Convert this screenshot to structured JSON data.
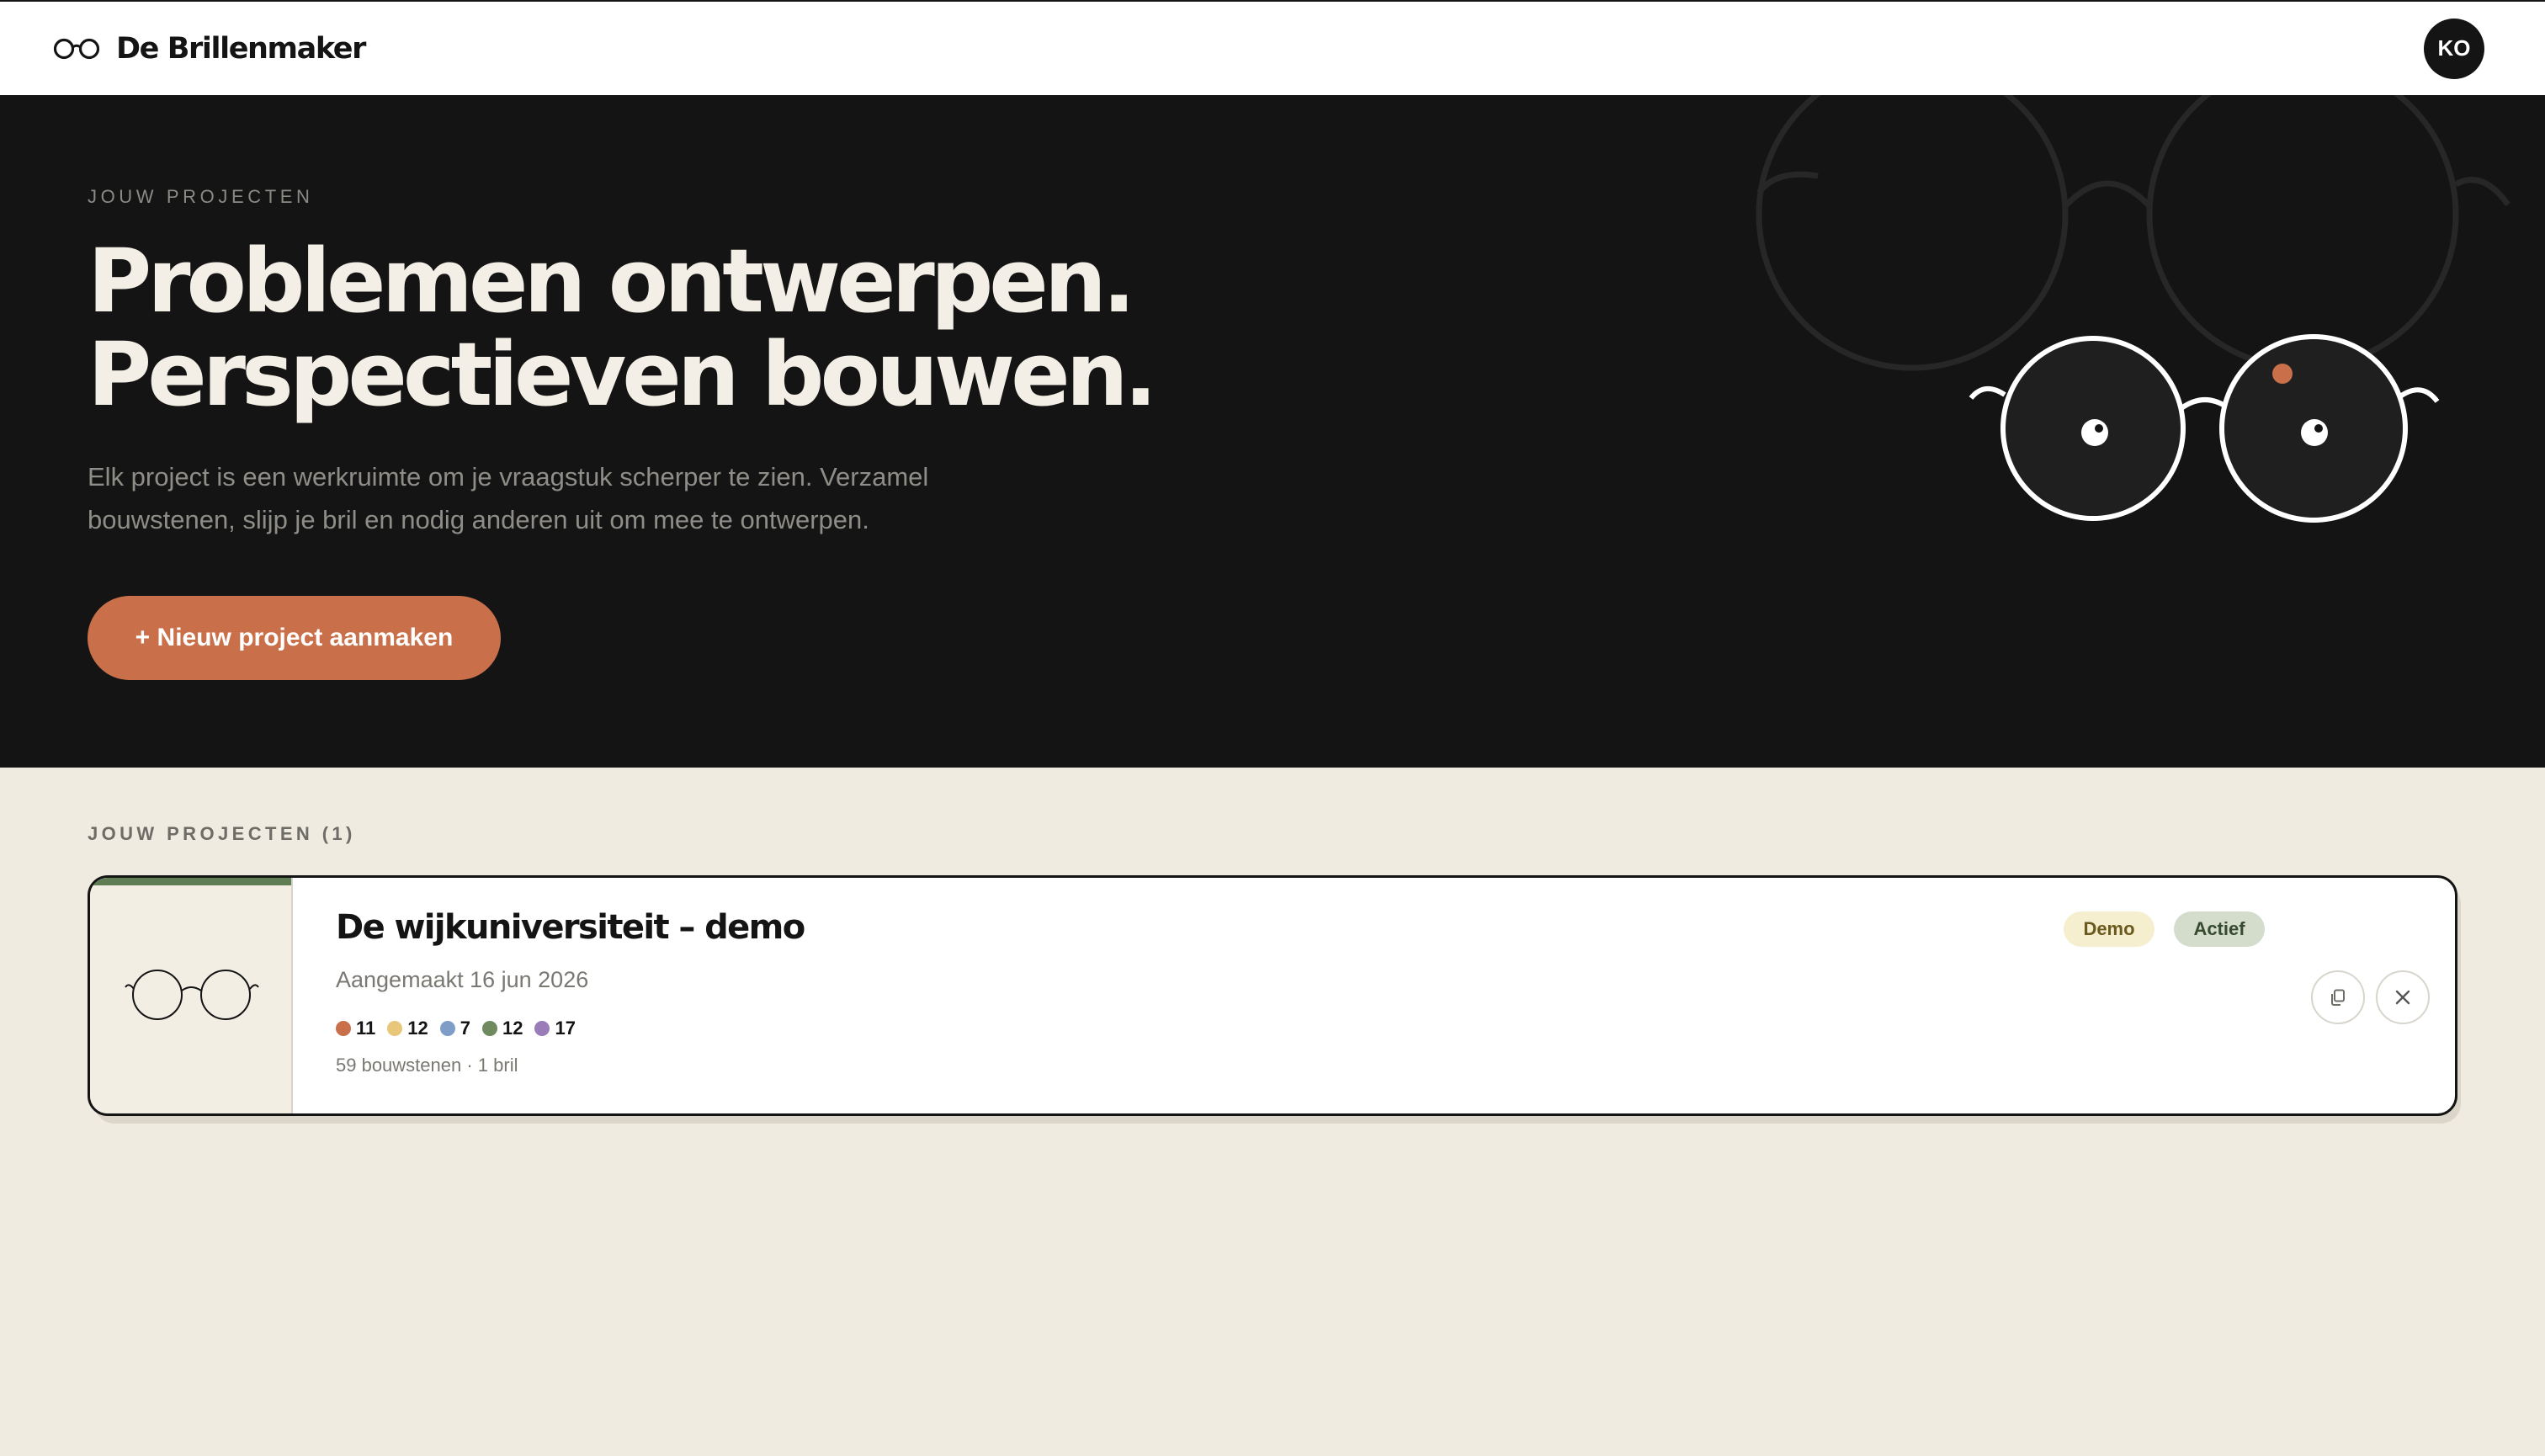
{
  "app": {
    "brand_name": "De Brillenmaker",
    "user_initials": "KO"
  },
  "hero": {
    "eyebrow": "JOUW PROJECTEN",
    "title_line1": "Problemen ontwerpen.",
    "title_line2": "Perspectieven bouwen.",
    "description": "Elk project is een werkruimte om je vraagstuk scherper te zien. Verzamel bouwstenen, slijp je bril en nodig anderen uit om mee te ontwerpen.",
    "new_project_label": "+ Nieuw project aanmaken"
  },
  "projects": {
    "section_label": "JOUW PROJECTEN (1)",
    "items": [
      {
        "title": "De wijkuniversiteit – demo",
        "created": "Aangemaakt 16 jun 2026",
        "counts": [
          {
            "value": "11",
            "color": "#c9704a"
          },
          {
            "value": "12",
            "color": "#e8c77a"
          },
          {
            "value": "7",
            "color": "#7e9ec8"
          },
          {
            "value": "12",
            "color": "#6e8a5e"
          },
          {
            "value": "17",
            "color": "#9a7cb8"
          }
        ],
        "meta": "59 bouwstenen · 1 bril",
        "badges": [
          "Demo",
          "Actief"
        ],
        "accent_color": "#5f7d55"
      }
    ]
  },
  "colors": {
    "hero_bg": "#141414",
    "page_bg": "#f0ebe0",
    "accent": "#c9704a"
  },
  "icons": {
    "logo": "glasses-icon",
    "copy": "copy-icon",
    "delete": "close-icon"
  }
}
